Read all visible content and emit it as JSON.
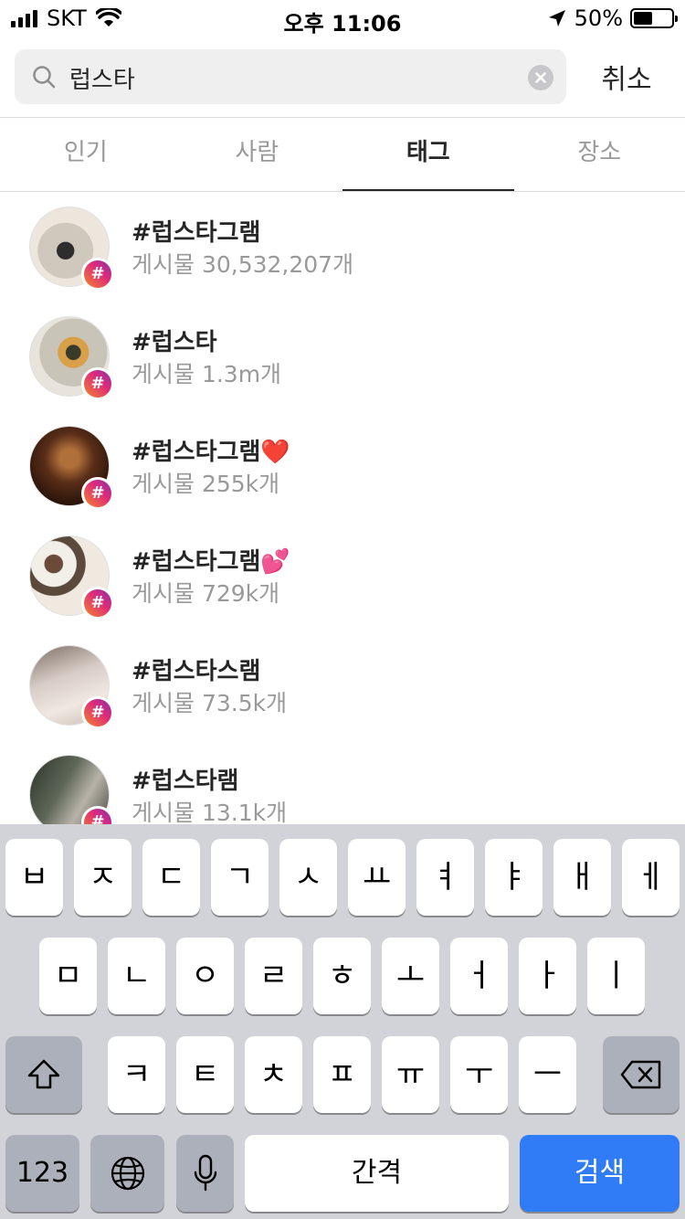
{
  "status_bar": {
    "carrier": "SKT",
    "time": "오후 11:06",
    "battery": "50%",
    "battery_level": 0.5
  },
  "search": {
    "query": "럽스타",
    "cancel_label": "취소"
  },
  "tabs": [
    {
      "label": "인기",
      "active": false
    },
    {
      "label": "사람",
      "active": false
    },
    {
      "label": "태그",
      "active": true
    },
    {
      "label": "장소",
      "active": false
    }
  ],
  "results": [
    {
      "tag": "#럽스타그램",
      "count": "게시물 30,532,207개"
    },
    {
      "tag": "#럽스타",
      "count": "게시물 1.3m개"
    },
    {
      "tag": "#럽스타그램❤️",
      "count": "게시물 255k개"
    },
    {
      "tag": "#럽스타그램💕",
      "count": "게시물 729k개"
    },
    {
      "tag": "#럽스타스램",
      "count": "게시물 73.5k개"
    },
    {
      "tag": "#럽스타램",
      "count": "게시물 13.1k개"
    }
  ],
  "hash_symbol": "#",
  "keyboard": {
    "row1": [
      "ㅂ",
      "ㅈ",
      "ㄷ",
      "ㄱ",
      "ㅅ",
      "ㅛ",
      "ㅕ",
      "ㅑ",
      "ㅐ",
      "ㅔ"
    ],
    "row2": [
      "ㅁ",
      "ㄴ",
      "ㅇ",
      "ㄹ",
      "ㅎ",
      "ㅗ",
      "ㅓ",
      "ㅏ",
      "ㅣ"
    ],
    "row3": [
      "ㅋ",
      "ㅌ",
      "ㅊ",
      "ㅍ",
      "ㅠ",
      "ㅜ",
      "ㅡ"
    ],
    "numbers_label": "123",
    "space_label": "간격",
    "search_label": "검색"
  },
  "colors": {
    "accent_blue": "#2f7cf6",
    "tab_active": "#262626",
    "muted_text": "#999999"
  }
}
